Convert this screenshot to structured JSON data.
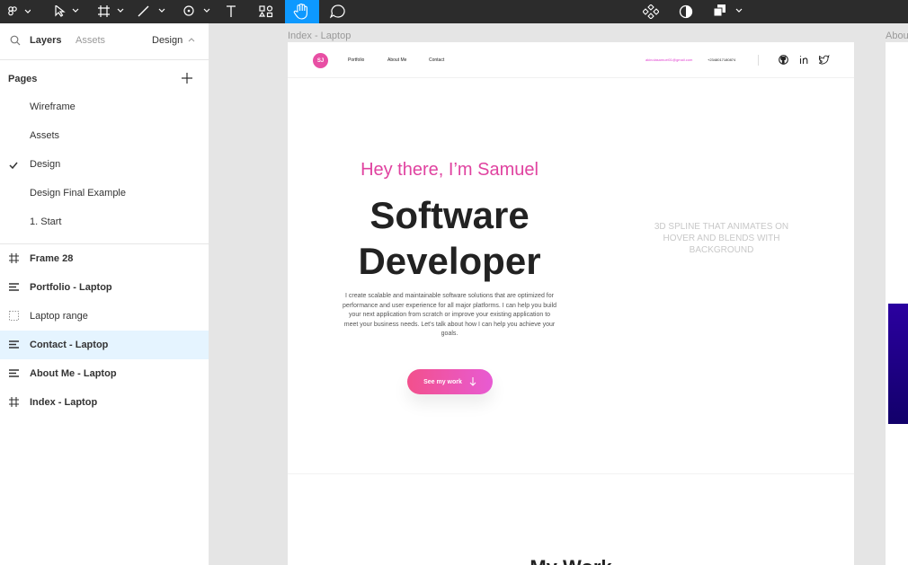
{
  "toolbar": {
    "tools": [
      "main-menu",
      "move",
      "frame",
      "pen",
      "shape",
      "text",
      "component",
      "hand",
      "comment"
    ],
    "right_tools": [
      "components",
      "mask",
      "boolean"
    ]
  },
  "left_panel": {
    "tabs": {
      "layers": "Layers",
      "assets": "Assets",
      "design": "Design"
    },
    "pages_title": "Pages",
    "pages": [
      {
        "label": "Wireframe",
        "current": false
      },
      {
        "label": "Assets",
        "current": false
      },
      {
        "label": "Design",
        "current": true
      },
      {
        "label": "Design Final Example",
        "current": false
      },
      {
        "label": "1. Start",
        "current": false
      }
    ],
    "layers": [
      {
        "label": "Frame 28",
        "icon": "frame-icon",
        "bold": true,
        "selected": false
      },
      {
        "label": "Portfolio - Laptop",
        "icon": "auto-layout-icon",
        "bold": true,
        "selected": false
      },
      {
        "label": "Laptop range",
        "icon": "section-dashed-icon",
        "bold": false,
        "selected": false
      },
      {
        "label": "Contact - Laptop",
        "icon": "auto-layout-icon",
        "bold": true,
        "selected": true
      },
      {
        "label": "About Me - Laptop",
        "icon": "auto-layout-icon",
        "bold": true,
        "selected": false
      },
      {
        "label": "Index - Laptop",
        "icon": "frame-icon",
        "bold": true,
        "selected": false
      }
    ]
  },
  "canvas": {
    "frame_index_label": "Index - Laptop",
    "frame_about_label": "Abou",
    "site": {
      "logo": "SJ",
      "nav": [
        "Portfolio",
        "About Me",
        "Contact"
      ],
      "email": "akinolasamuel01@gmail.com",
      "phone": "+2348017180874",
      "greeting": "Hey there, I’m Samuel",
      "headline_line1": "Software",
      "headline_line2": "Developer",
      "bio": "I create scalable and maintainable software solutions that are optimized for performance and user experience for all major platforms. I can help you build your next application from scratch or improve your existing application to meet your business needs. Let's talk about how I can help you achieve your goals.",
      "cta": "See my work",
      "spline_note": "3D SPLINE THAT ANIMATES ON HOVER AND BLENDS WITH BACKGROUND",
      "section_title": "My Work"
    }
  },
  "colors": {
    "toolbar_bg": "#2c2c2c",
    "active_tool": "#0d99ff",
    "accent_pink": "#e043a0",
    "selected_layer": "#e5f4ff"
  }
}
